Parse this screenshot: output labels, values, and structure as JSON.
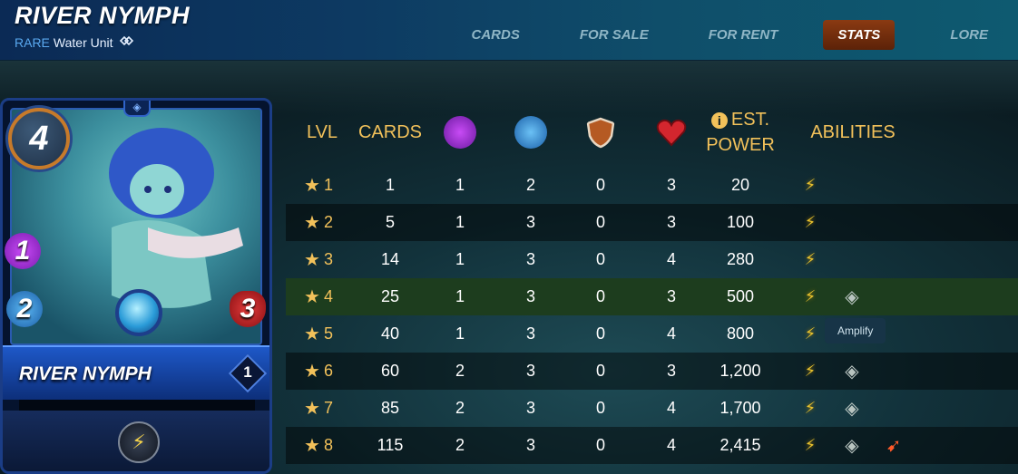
{
  "header": {
    "title": "RIVER NYMPH",
    "rarity": "RARE",
    "unit_type": "Water Unit",
    "tabs": [
      {
        "label": "CARDS",
        "active": false
      },
      {
        "label": "FOR SALE",
        "active": false
      },
      {
        "label": "FOR RENT",
        "active": false
      },
      {
        "label": "STATS",
        "active": true
      },
      {
        "label": "LORE",
        "active": false
      }
    ]
  },
  "card": {
    "name": "RIVER NYMPH",
    "mana": "4",
    "magic": "1",
    "ranged": "2",
    "health": "3",
    "level": "1"
  },
  "table": {
    "headers": {
      "lvl": "LVL",
      "cards": "CARDS",
      "magic_icon": "magic-icon",
      "speed_icon": "speed-icon",
      "armor_icon": "armor-icon",
      "health_icon": "health-icon",
      "power_line1": "EST.",
      "power_line2": "POWER",
      "abilities": "ABILITIES"
    },
    "rows": [
      {
        "lvl": "1",
        "cards": "1",
        "magic": "1",
        "speed": "2",
        "armor": "0",
        "health": "3",
        "power": "20",
        "abilities": [
          "bolt"
        ]
      },
      {
        "lvl": "2",
        "cards": "5",
        "magic": "1",
        "speed": "3",
        "armor": "0",
        "health": "3",
        "power": "100",
        "abilities": [
          "bolt"
        ]
      },
      {
        "lvl": "3",
        "cards": "14",
        "magic": "1",
        "speed": "3",
        "armor": "0",
        "health": "4",
        "power": "280",
        "abilities": [
          "bolt"
        ]
      },
      {
        "lvl": "4",
        "cards": "25",
        "magic": "1",
        "speed": "3",
        "armor": "0",
        "health": "3",
        "power": "500",
        "abilities": [
          "bolt",
          "amplify"
        ]
      },
      {
        "lvl": "5",
        "cards": "40",
        "magic": "1",
        "speed": "3",
        "armor": "0",
        "health": "4",
        "power": "800",
        "abilities": [
          "bolt"
        ]
      },
      {
        "lvl": "6",
        "cards": "60",
        "magic": "2",
        "speed": "3",
        "armor": "0",
        "health": "3",
        "power": "1,200",
        "abilities": [
          "bolt",
          "amplify"
        ]
      },
      {
        "lvl": "7",
        "cards": "85",
        "magic": "2",
        "speed": "3",
        "armor": "0",
        "health": "4",
        "power": "1,700",
        "abilities": [
          "bolt",
          "amplify"
        ]
      },
      {
        "lvl": "8",
        "cards": "115",
        "magic": "2",
        "speed": "3",
        "armor": "0",
        "health": "4",
        "power": "2,415",
        "abilities": [
          "bolt",
          "amplify",
          "swiftness"
        ]
      }
    ],
    "highlighted_row": 4
  },
  "tooltip": {
    "text": "Amplify"
  },
  "colors": {
    "accent_gold": "#f2c15a",
    "active_tab": "#8a3a12",
    "highlight_row": "#1d3d1e",
    "rarity_blue": "#5aa9f0"
  }
}
